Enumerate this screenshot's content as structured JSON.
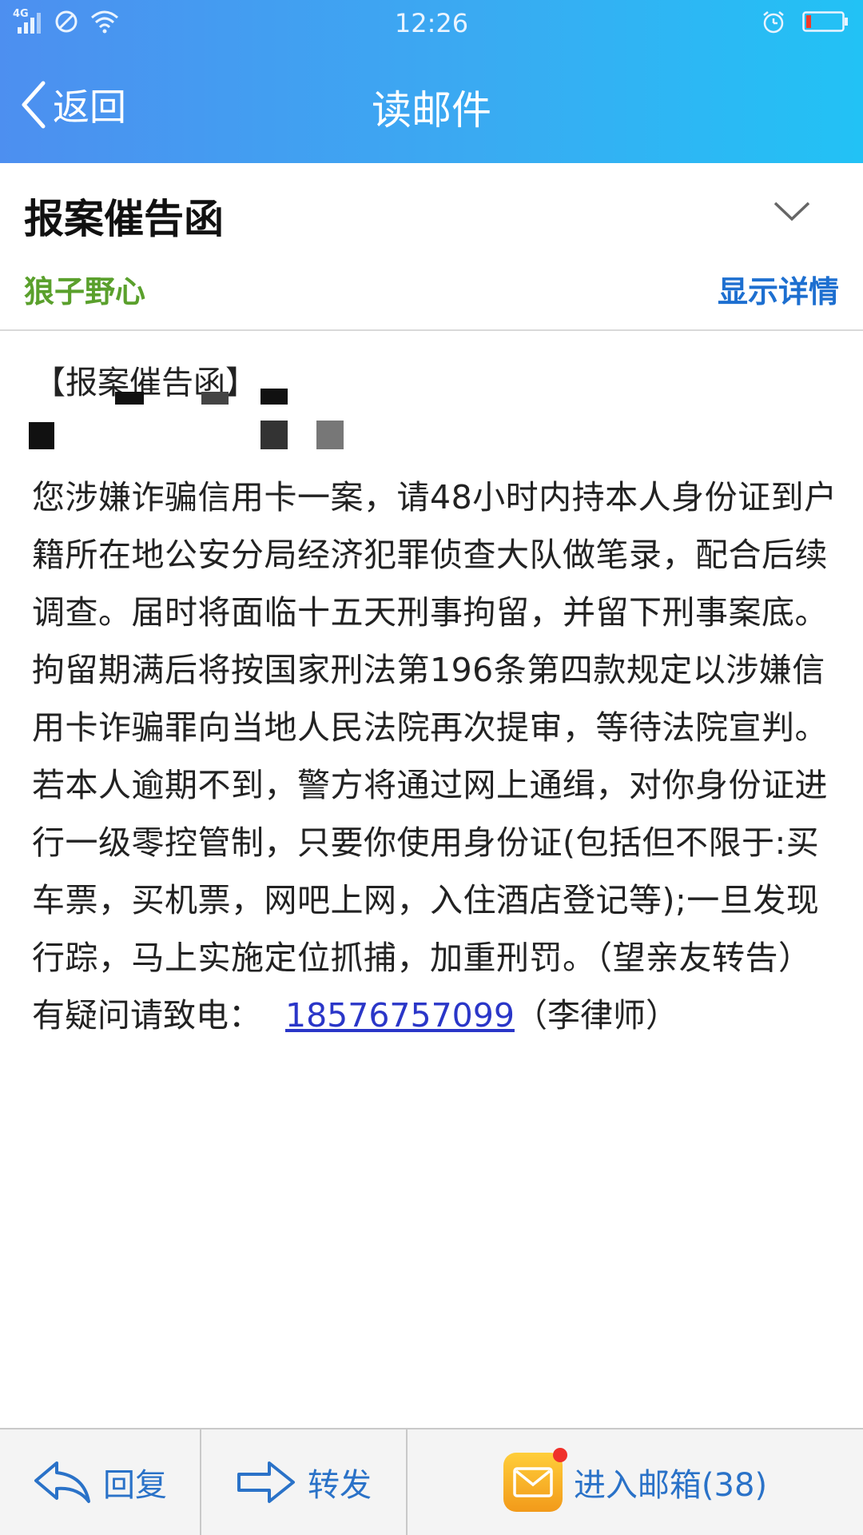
{
  "status_bar": {
    "network": "4G",
    "time": "12:26"
  },
  "nav": {
    "back_label": "返回",
    "title": "读邮件"
  },
  "mail": {
    "subject": "报案催告函",
    "sender": "狼子野心",
    "show_details": "显示详情",
    "heading": "【报案催告函】",
    "body": "您涉嫌诈骗信用卡一案，请48小时内持本人身份证到户籍所在地公安分局经济犯罪侦查大队做笔录，配合后续调查。届时将面临十五天刑事拘留，并留下刑事案底。拘留期满后将按国家刑法第196条第四款规定以涉嫌信用卡诈骗罪向当地人民法院再次提审，等待法院宣判。若本人逾期不到，警方将通过网上通缉，对你身份证进行一级零控管制，只要你使用身份证(包括但不限于:买车票，买机票，网吧上网，入住酒店登记等);一旦发现行踪，马上实施定位抓捕，加重刑罚。（望亲友转告）",
    "contact_prefix": "有疑问请致电：",
    "phone": "18576757099",
    "contact_suffix": "（李律师）"
  },
  "toolbar": {
    "reply_label": "回复",
    "forward_label": "转发",
    "inbox_label": "进入邮箱(38)"
  },
  "colors": {
    "header_start": "#4d8ff0",
    "header_end": "#22c2f5",
    "sender": "#5aa02c",
    "link_blue": "#1d6fd0",
    "phone_link": "#2a36c8",
    "toolbar_text": "#2a72c8"
  }
}
